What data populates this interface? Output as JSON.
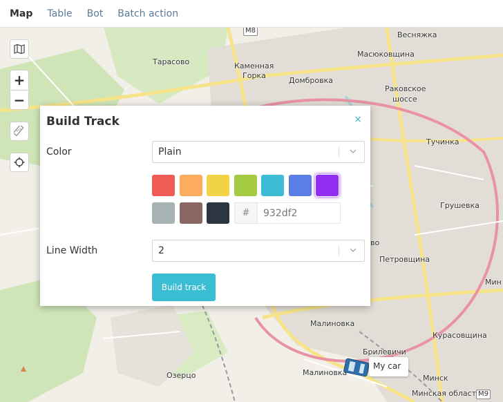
{
  "tabs": [
    {
      "label": "Map",
      "active": true
    },
    {
      "label": "Table",
      "active": false
    },
    {
      "label": "Bot",
      "active": false
    },
    {
      "label": "Batch action",
      "active": false
    }
  ],
  "map": {
    "labels": [
      "Весняжка",
      "Масюковщина",
      "Тарасово",
      "Каменная",
      "Горка",
      "Домбровка",
      "Раковское",
      "шоссе",
      "Тучинка",
      "Грушевка",
      "во",
      "Петровщина",
      "Мин",
      "Малиновка",
      "Брилевичи",
      "Курасовщина",
      "Озерцо",
      "Малиновка",
      "Минск",
      "Минская область"
    ],
    "road_badges": [
      "M8",
      "M9"
    ]
  },
  "controls": {
    "layers_icon": "map-layers-icon",
    "zoom_in": "+",
    "zoom_out": "−",
    "ruler_icon": "ruler-icon",
    "locate_icon": "crosshair-icon"
  },
  "marker": {
    "label": "My car",
    "icon": "car-icon"
  },
  "dialog": {
    "title": "Build Track",
    "close": "×",
    "color_label": "Color",
    "color_value": "Plain",
    "hash": "#",
    "hex_value": "932df2",
    "line_width_label": "Line Width",
    "line_width_value": "2",
    "build_button": "Build track",
    "palette": [
      "#ef5b55",
      "#fdac5e",
      "#f2d346",
      "#a3cc41",
      "#3cbdd3",
      "#5a7ee6",
      "#932df2",
      "#a7b2b4",
      "#8a6763",
      "#2b3641"
    ],
    "selected_color": "#932df2"
  }
}
